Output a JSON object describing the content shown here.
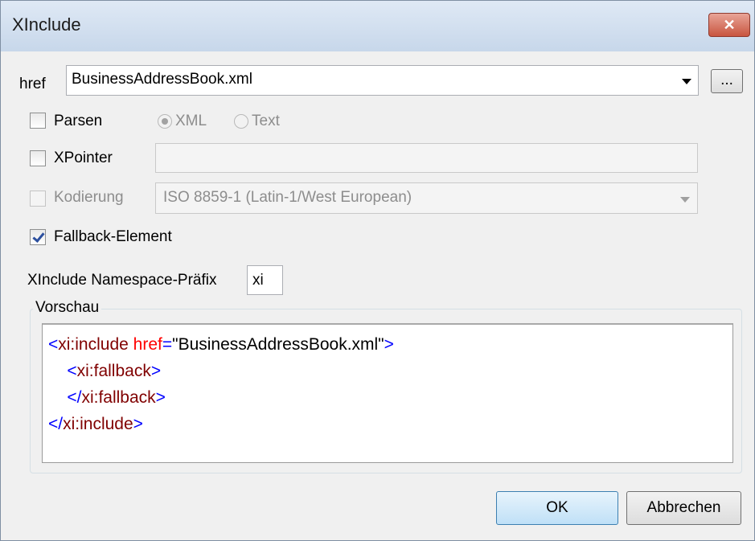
{
  "window": {
    "title": "XInclude"
  },
  "href": {
    "label": "href",
    "value": "BusinessAddressBook.xml",
    "browse_label": "..."
  },
  "parsen": {
    "label": "Parsen",
    "checked": false,
    "options": [
      {
        "label": "XML",
        "selected": true
      },
      {
        "label": "Text",
        "selected": false
      }
    ]
  },
  "xpointer": {
    "label": "XPointer",
    "checked": false,
    "value": ""
  },
  "kodierung": {
    "label": "Kodierung",
    "checked": false,
    "value": "ISO 8859-1 (Latin-1/West European)"
  },
  "fallback": {
    "label": "Fallback-Element",
    "checked": true
  },
  "namespace": {
    "label": "XInclude Namespace-Präfix",
    "value": "xi"
  },
  "preview": {
    "label": "Vorschau",
    "line1": {
      "open": "<",
      "name": "xi:include",
      "attr": "href",
      "eq": "=",
      "value": "\"BusinessAddressBook.xml\"",
      "close": ">"
    },
    "line2": {
      "indent": "    ",
      "open": "<",
      "name": "xi:fallback",
      "close": ">"
    },
    "line3": {
      "indent": "    ",
      "open": "</",
      "name": "xi:fallback",
      "close": ">"
    },
    "line4": {
      "open": "</",
      "name": "xi:include",
      "close": ">"
    }
  },
  "buttons": {
    "ok": "OK",
    "cancel": "Abbrechen"
  },
  "colors": {
    "tag": "#0000ff",
    "attribute": "#ff0000",
    "string": "#000000",
    "titlebar": "#c7d7ea",
    "close": "#c8553f"
  }
}
